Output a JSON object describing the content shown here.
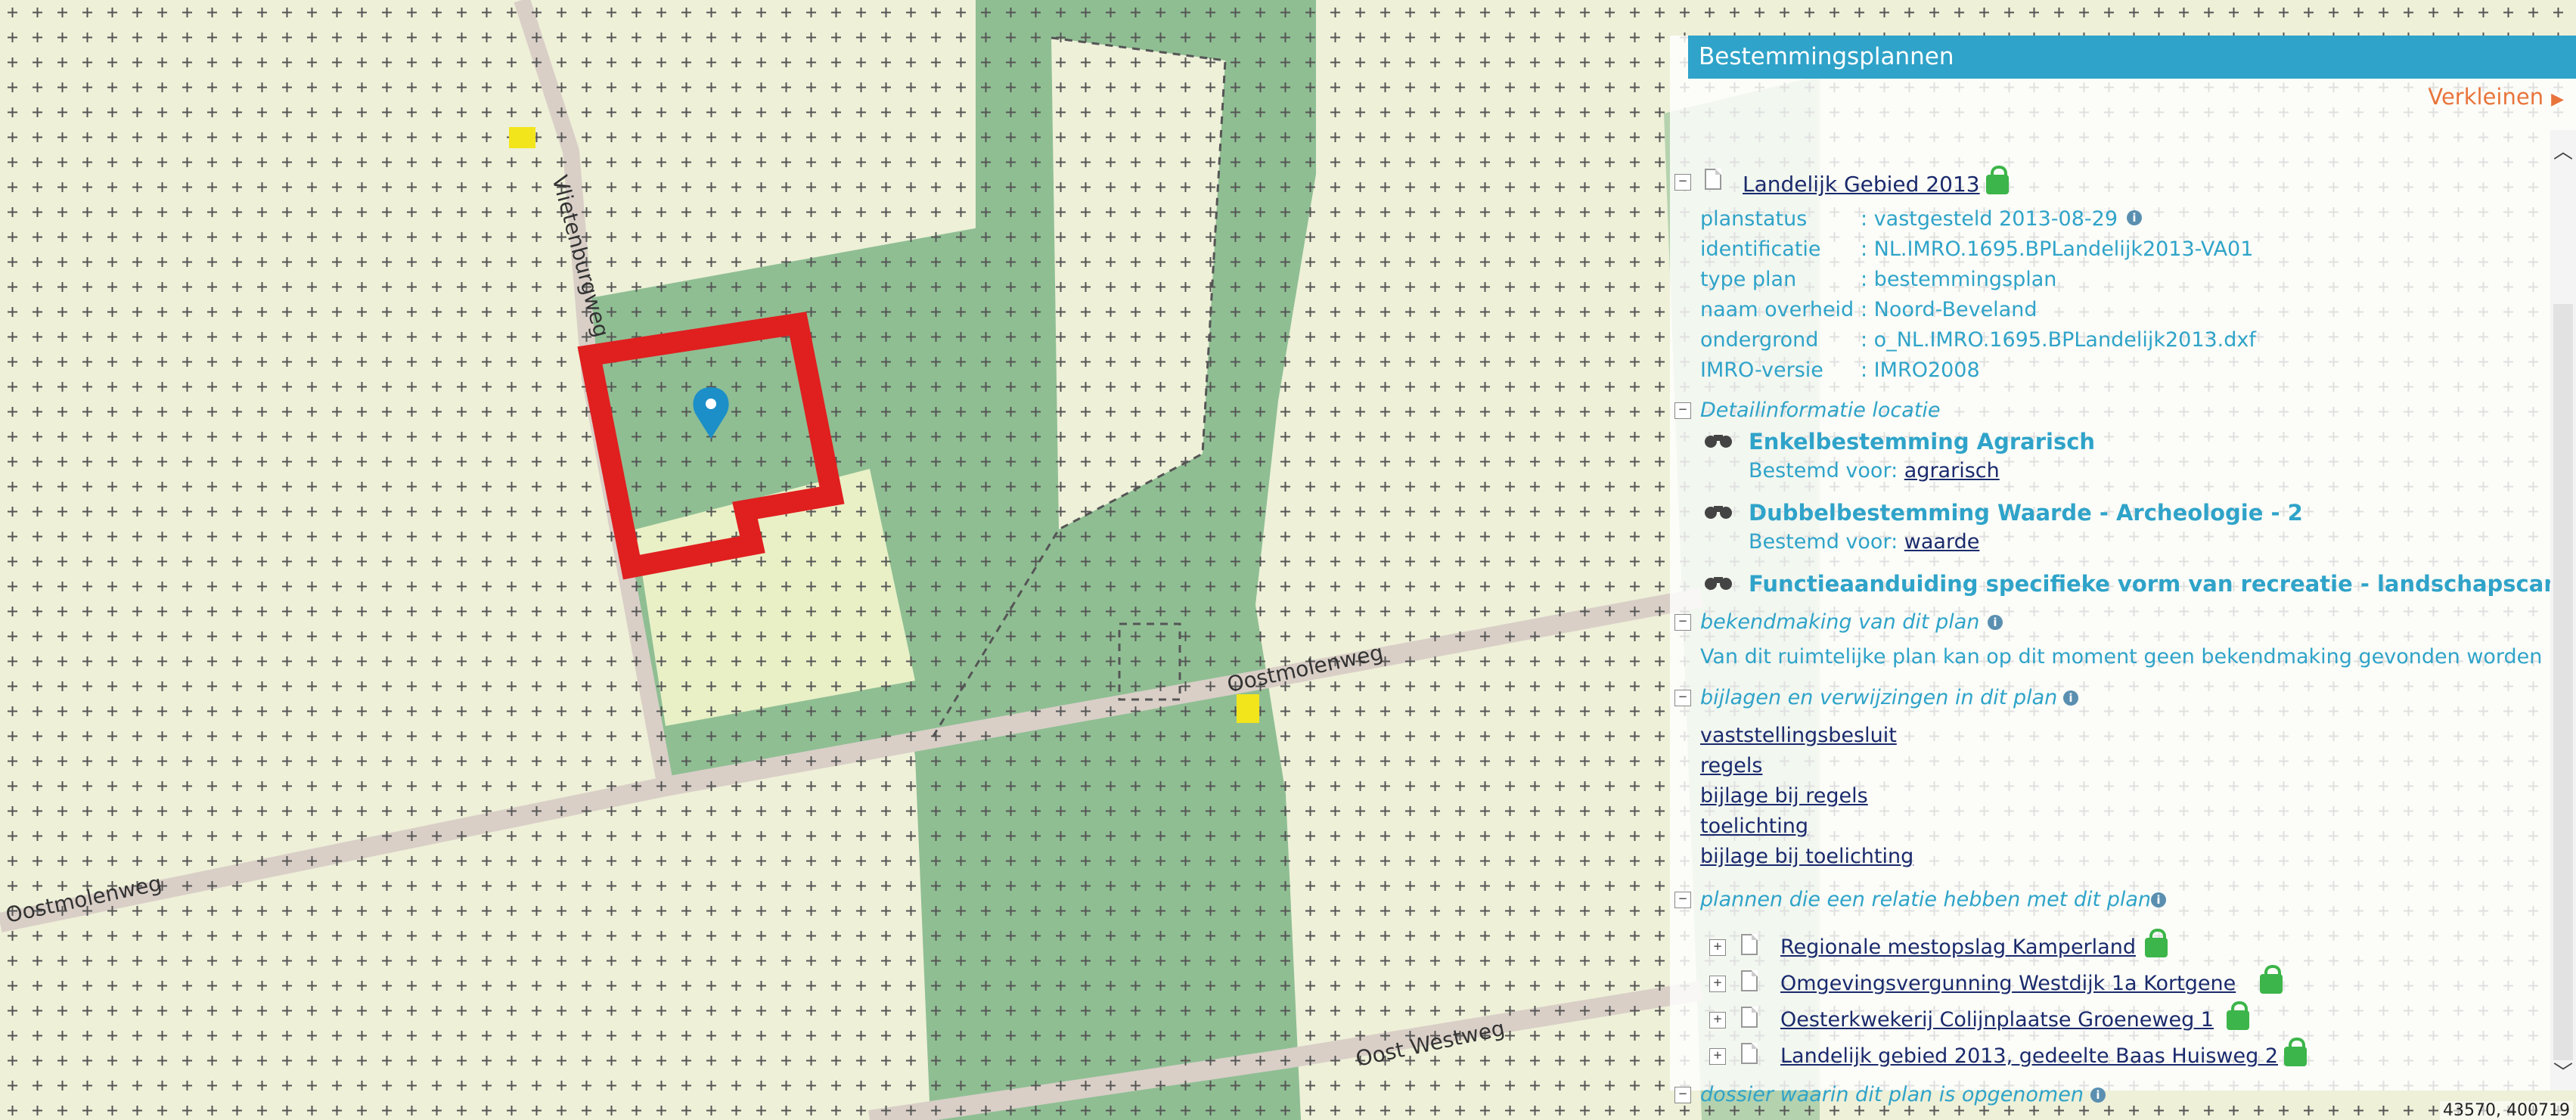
{
  "map": {
    "roads": [
      {
        "name": "Vlietenburgweg"
      },
      {
        "name": "Oostmolenweg"
      },
      {
        "name": "Oostmolenweg"
      },
      {
        "name": "Oost Westweg"
      }
    ],
    "coordinates": "43570, 400719",
    "colors": {
      "base": "#eef0d8",
      "green": "#8fbe93",
      "road": "#d9cfc7",
      "selection": "#e01f1f",
      "marker": "#1c8fc8",
      "yellow": "#f2e51b"
    }
  },
  "panel": {
    "title": "Bestemmingsplannen",
    "collapse_label": "Verkleinen",
    "plan": {
      "name": "Landelijk Gebied 2013",
      "fields": [
        {
          "key": "planstatus",
          "value": ": vastgesteld 2013-08-29"
        },
        {
          "key": "identificatie",
          "value": ": NL.IMRO.1695.BPLandelijk2013-VA01"
        },
        {
          "key": "type plan",
          "value": ": bestemmingsplan"
        },
        {
          "key": "naam overheid",
          "value": ": Noord-Beveland"
        },
        {
          "key": "ondergrond",
          "value": ": o_NL.IMRO.1695.BPLandelijk2013.dxf"
        },
        {
          "key": "IMRO-versie",
          "value": ": IMRO2008"
        }
      ]
    },
    "detail": {
      "heading": "Detailinformatie locatie",
      "items": [
        {
          "title": "Enkelbestemming Agrarisch",
          "sub_label": "Bestemd voor:",
          "sub_link": "agrarisch"
        },
        {
          "title": "Dubbelbestemming Waarde - Archeologie - 2",
          "sub_label": "Bestemd voor:",
          "sub_link": "waarde"
        },
        {
          "title": "Functieaanduiding specifieke vorm van recreatie - landschapscamping"
        }
      ]
    },
    "bekendmaking": {
      "heading": "bekendmaking van dit plan",
      "text": "Van dit ruimtelijke plan kan op dit moment geen bekendmaking gevonden worden"
    },
    "bijlagen": {
      "heading": "bijlagen en verwijzingen in dit plan",
      "links": [
        "vaststellingsbesluit",
        "regels",
        "bijlage bij regels",
        "toelichting",
        "bijlage bij toelichting"
      ]
    },
    "relaties": {
      "heading": "plannen die een relatie hebben met dit plan",
      "plans": [
        "Regionale mestopslag Kamperland",
        "Omgevingsvergunning Westdijk 1a Kortgene",
        "Oesterkwekerij Colijnplaatse Groeneweg 1",
        "Landelijk gebied 2013, gedeelte Baas Huisweg 2"
      ]
    },
    "dossier": {
      "heading": "dossier waarin dit plan is opgenomen"
    }
  }
}
